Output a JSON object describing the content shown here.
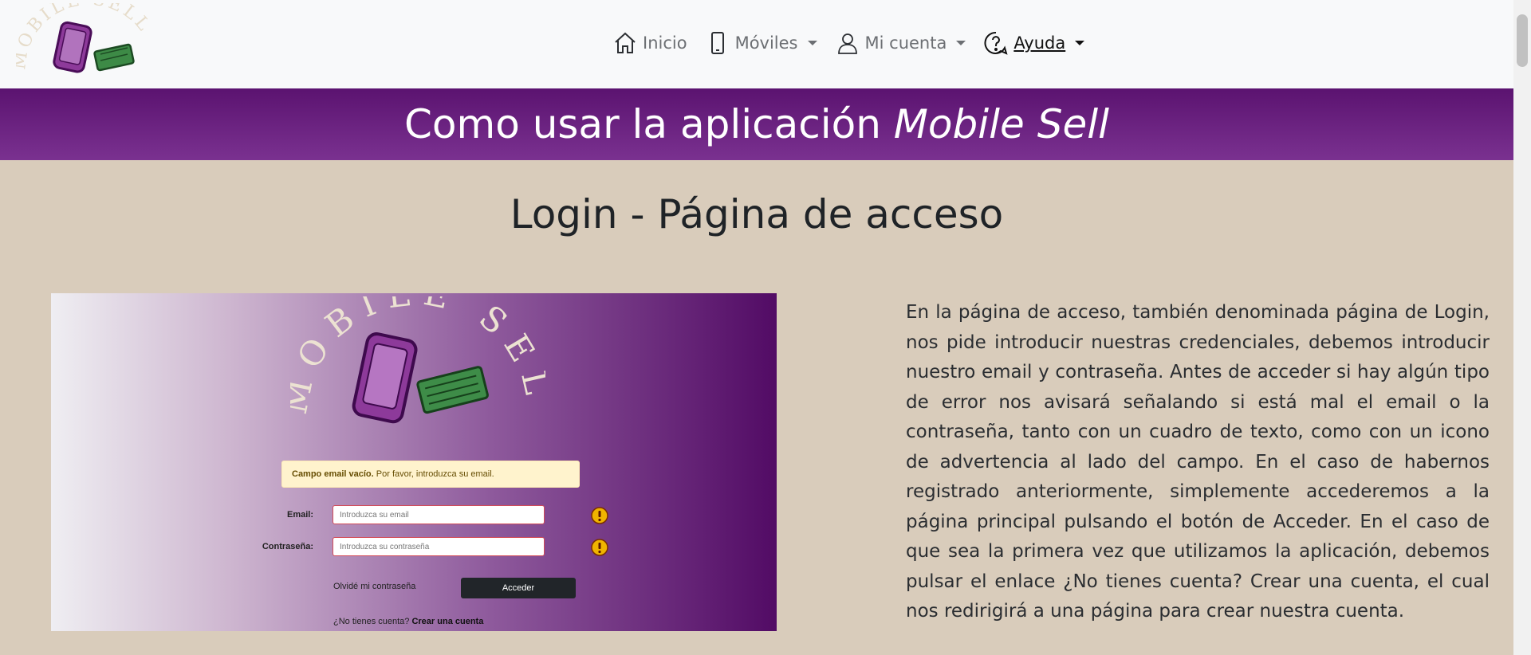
{
  "brand": {
    "logo_text": "MOBILE SELL"
  },
  "nav": {
    "items": [
      {
        "label": "Inicio",
        "icon": "home-icon"
      },
      {
        "label": "Móviles",
        "icon": "phone-icon",
        "dropdown": true
      },
      {
        "label": "Mi cuenta",
        "icon": "user-icon",
        "dropdown": true
      },
      {
        "label": "Ayuda",
        "icon": "help-icon",
        "dropdown": true,
        "active": true
      }
    ]
  },
  "banner": {
    "title_prefix": "Como usar la aplicación ",
    "title_app": "Mobile Sell"
  },
  "section": {
    "title": "Login - Página de acceso",
    "description": "En la página de acceso, también denominada página de Login, nos pide introducir nuestras credenciales, debemos introducir nuestro email y contraseña. Antes de acceder si hay algún tipo de error nos avisará señalando si está mal el email o la contraseña, tanto con un cuadro de texto, como con un icono de advertencia al lado del campo. En el caso de habernos registrado anteriormente, simplemente accederemos a la página principal pulsando el botón de Acceder. En el caso de que sea la primera vez que utilizamos la aplicación, debemos pulsar el enlace ¿No tienes cuenta? Crear una cuenta, el cual nos redirigirá a una página para crear nuestra cuenta."
  },
  "screenshot": {
    "alert_strong": "Campo email vacío.",
    "alert_text": " Por favor, introduzca su email.",
    "email_label": "Email:",
    "email_placeholder": "Introduzca su email",
    "password_label": "Contraseña:",
    "password_placeholder": "Introduzca su contraseña",
    "forgot_label": "Olvidé mi contraseña",
    "submit_label": "Acceder",
    "signup_prompt": "¿No tienes cuenta? ",
    "signup_link": "Crear una cuenta"
  },
  "colors": {
    "banner": "#6a2180",
    "background": "#d9ccbb",
    "accent_dark": "#212529",
    "warning": "#f0b400"
  }
}
